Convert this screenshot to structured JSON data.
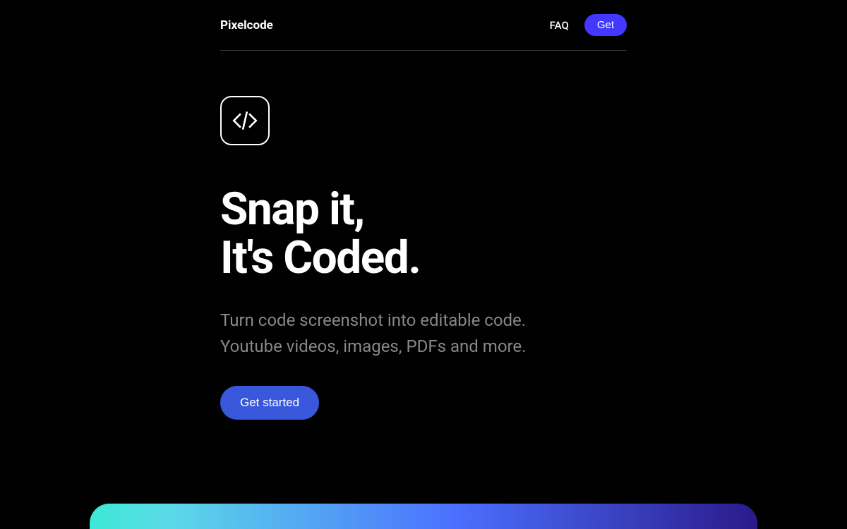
{
  "header": {
    "brand": "Pixelcode",
    "nav": {
      "faq_label": "FAQ",
      "get_label": "Get"
    }
  },
  "hero": {
    "icon_name": "code-brackets-icon",
    "title_line1": "Snap it,",
    "title_line2": "It's Coded.",
    "subtitle_line1": "Turn code screenshot into editable code.",
    "subtitle_line2": "Youtube videos, images, PDFs and more.",
    "cta_label": "Get started"
  }
}
